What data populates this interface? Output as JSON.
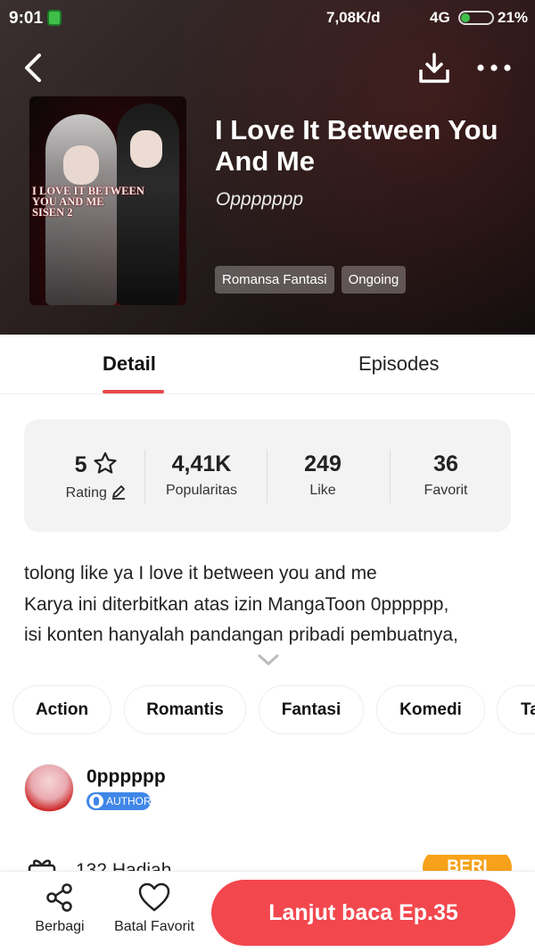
{
  "status_bar": {
    "time": "9:01",
    "speed": "7,08K/d",
    "network": "4G",
    "battery": "21%"
  },
  "book": {
    "title": "I Love It Between You And Me",
    "author": "Oppppppp",
    "cover_text": "I LOVE IT BETWEEN\nYOU AND ME\nSISEN 2",
    "tags": [
      "Romansa Fantasi",
      "Ongoing"
    ]
  },
  "tabs": {
    "detail": "Detail",
    "episodes": "Episodes"
  },
  "stats": [
    {
      "value": "5",
      "label": "Rating"
    },
    {
      "value": "4,41K",
      "label": "Popularitas"
    },
    {
      "value": "249",
      "label": "Like"
    },
    {
      "value": "36",
      "label": "Favorit"
    }
  ],
  "description": [
    "tolong like ya I love it between you and me",
    "Karya ini diterbitkan atas izin MangaToon 0pppppp,",
    "isi konten hanyalah pandangan pribadi pembuatnya,"
  ],
  "genres": [
    "Action",
    "Romantis",
    "Fantasi",
    "Komedi",
    "Ta"
  ],
  "author_section": {
    "name": "0pppppp",
    "badge": "AUTHOR"
  },
  "gift": {
    "text": "132 Hadiah",
    "button": "BERI"
  },
  "bottom_bar": {
    "share": "Berbagi",
    "favorite": "Batal Favorit",
    "cta": "Lanjut baca Ep.35"
  },
  "colors": {
    "accent": "#f2474d",
    "tab_indicator": "#e84a4a",
    "badge": "#3f86e8",
    "gift_button": "#f7a21a"
  }
}
